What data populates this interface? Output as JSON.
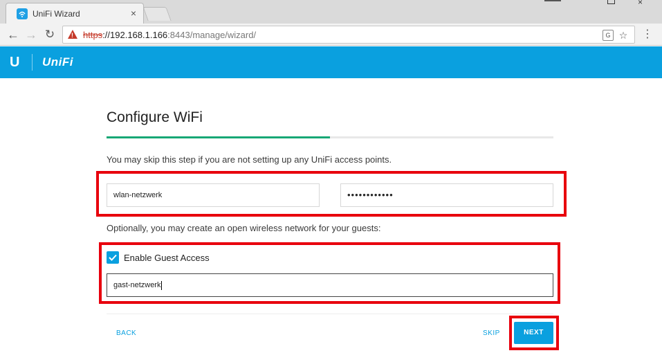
{
  "browser": {
    "tab_title": "UniFi Wizard",
    "tab_close_glyph": "×",
    "url_scheme": "https",
    "url_host": "://192.168.1.166",
    "url_rest": ":8443/manage/wizard/",
    "translate_glyph": "G",
    "star_glyph": "☆",
    "menu_glyph": "⋮",
    "back_glyph": "←",
    "forward_glyph": "→",
    "reload_glyph": "↻",
    "window_close_glyph": "×"
  },
  "appbar": {
    "brand_mark": "U",
    "product_name": "UniFi",
    "background_color": "#0aa0df"
  },
  "wizard": {
    "title": "Configure WiFi",
    "progress_fraction": 0.5,
    "progress_color": "#17a775",
    "skip_hint": "You may skip this step if you are not setting up any UniFi access points.",
    "ssid_value": "wlan-netzwerk",
    "password_value": "••••••••••••",
    "guest_hint": "Optionally, you may create an open wireless network for your guests:",
    "guest_checkbox_label": "Enable Guest Access",
    "guest_checkbox_checked": true,
    "guest_ssid_value": "gast-netzwerk",
    "back_label": "BACK",
    "skip_label": "SKIP",
    "next_label": "NEXT",
    "highlight_color": "#e8000d"
  }
}
